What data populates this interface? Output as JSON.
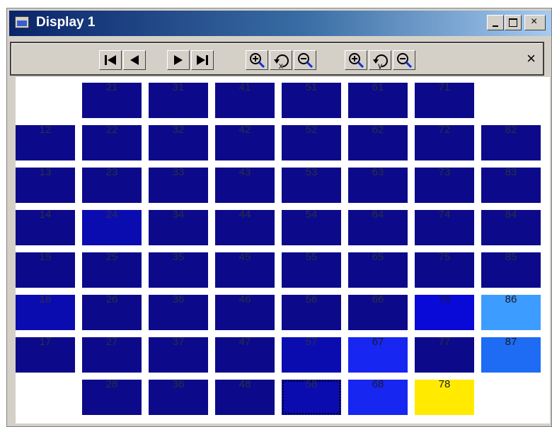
{
  "window": {
    "title": "Display 1",
    "buttons": {
      "minimize": "minimize",
      "maximize": "maximize",
      "close": "×"
    }
  },
  "toolbar": {
    "tools": [
      {
        "name": "first-frame-button",
        "icon": "skip-to-start-icon"
      },
      {
        "name": "previous-frame-button",
        "icon": "step-back-icon"
      },
      {
        "name": "next-frame-button",
        "icon": "step-forward-icon"
      },
      {
        "name": "last-frame-button",
        "icon": "skip-to-end-icon"
      },
      {
        "name": "zoom-in-x-button",
        "icon": "zoom-in-icon"
      },
      {
        "name": "reset-zoom-x-button",
        "icon": "reset-x-icon"
      },
      {
        "name": "zoom-out-x-button",
        "icon": "zoom-out-icon"
      },
      {
        "name": "zoom-in-y-button",
        "icon": "zoom-in-icon"
      },
      {
        "name": "reset-zoom-y-button",
        "icon": "reset-y-icon"
      },
      {
        "name": "zoom-out-y-button",
        "icon": "zoom-out-icon"
      }
    ],
    "close_label": "×"
  },
  "colors": {
    "dark": "#0c0a8a",
    "mid": "#0b0cb0",
    "bright": "#0a0ad8",
    "blue": "#1726f0",
    "sky": "#3d9cff",
    "azure": "#1e6cf4",
    "yellow": "#ffea00"
  },
  "cells": [
    {
      "label": "21",
      "col": 1,
      "row": 0,
      "color": "dark"
    },
    {
      "label": "31",
      "col": 2,
      "row": 0,
      "color": "dark"
    },
    {
      "label": "41",
      "col": 3,
      "row": 0,
      "color": "dark"
    },
    {
      "label": "51",
      "col": 4,
      "row": 0,
      "color": "dark"
    },
    {
      "label": "61",
      "col": 5,
      "row": 0,
      "color": "dark"
    },
    {
      "label": "71",
      "col": 6,
      "row": 0,
      "color": "dark"
    },
    {
      "label": "12",
      "col": 0,
      "row": 1,
      "color": "dark"
    },
    {
      "label": "22",
      "col": 1,
      "row": 1,
      "color": "dark"
    },
    {
      "label": "32",
      "col": 2,
      "row": 1,
      "color": "dark"
    },
    {
      "label": "42",
      "col": 3,
      "row": 1,
      "color": "dark"
    },
    {
      "label": "52",
      "col": 4,
      "row": 1,
      "color": "dark"
    },
    {
      "label": "62",
      "col": 5,
      "row": 1,
      "color": "dark"
    },
    {
      "label": "72",
      "col": 6,
      "row": 1,
      "color": "dark"
    },
    {
      "label": "82",
      "col": 7,
      "row": 1,
      "color": "dark"
    },
    {
      "label": "13",
      "col": 0,
      "row": 2,
      "color": "dark"
    },
    {
      "label": "23",
      "col": 1,
      "row": 2,
      "color": "dark"
    },
    {
      "label": "33",
      "col": 2,
      "row": 2,
      "color": "dark"
    },
    {
      "label": "43",
      "col": 3,
      "row": 2,
      "color": "dark"
    },
    {
      "label": "53",
      "col": 4,
      "row": 2,
      "color": "dark"
    },
    {
      "label": "63",
      "col": 5,
      "row": 2,
      "color": "dark"
    },
    {
      "label": "73",
      "col": 6,
      "row": 2,
      "color": "dark"
    },
    {
      "label": "83",
      "col": 7,
      "row": 2,
      "color": "dark"
    },
    {
      "label": "14",
      "col": 0,
      "row": 3,
      "color": "dark"
    },
    {
      "label": "24",
      "col": 1,
      "row": 3,
      "color": "mid"
    },
    {
      "label": "34",
      "col": 2,
      "row": 3,
      "color": "dark"
    },
    {
      "label": "44",
      "col": 3,
      "row": 3,
      "color": "dark"
    },
    {
      "label": "54",
      "col": 4,
      "row": 3,
      "color": "dark"
    },
    {
      "label": "64",
      "col": 5,
      "row": 3,
      "color": "dark"
    },
    {
      "label": "74",
      "col": 6,
      "row": 3,
      "color": "dark"
    },
    {
      "label": "84",
      "col": 7,
      "row": 3,
      "color": "dark"
    },
    {
      "label": "15",
      "col": 0,
      "row": 4,
      "color": "dark"
    },
    {
      "label": "25",
      "col": 1,
      "row": 4,
      "color": "dark"
    },
    {
      "label": "35",
      "col": 2,
      "row": 4,
      "color": "dark"
    },
    {
      "label": "45",
      "col": 3,
      "row": 4,
      "color": "dark"
    },
    {
      "label": "55",
      "col": 4,
      "row": 4,
      "color": "dark"
    },
    {
      "label": "65",
      "col": 5,
      "row": 4,
      "color": "dark"
    },
    {
      "label": "75",
      "col": 6,
      "row": 4,
      "color": "dark"
    },
    {
      "label": "85",
      "col": 7,
      "row": 4,
      "color": "dark"
    },
    {
      "label": "16",
      "col": 0,
      "row": 5,
      "color": "mid"
    },
    {
      "label": "26",
      "col": 1,
      "row": 5,
      "color": "dark"
    },
    {
      "label": "36",
      "col": 2,
      "row": 5,
      "color": "dark"
    },
    {
      "label": "46",
      "col": 3,
      "row": 5,
      "color": "dark"
    },
    {
      "label": "56",
      "col": 4,
      "row": 5,
      "color": "dark"
    },
    {
      "label": "66",
      "col": 5,
      "row": 5,
      "color": "dark"
    },
    {
      "label": "76",
      "col": 6,
      "row": 5,
      "color": "bright"
    },
    {
      "label": "86",
      "col": 7,
      "row": 5,
      "color": "sky"
    },
    {
      "label": "17",
      "col": 0,
      "row": 6,
      "color": "dark"
    },
    {
      "label": "27",
      "col": 1,
      "row": 6,
      "color": "dark"
    },
    {
      "label": "37",
      "col": 2,
      "row": 6,
      "color": "dark"
    },
    {
      "label": "47",
      "col": 3,
      "row": 6,
      "color": "dark"
    },
    {
      "label": "57",
      "col": 4,
      "row": 6,
      "color": "mid"
    },
    {
      "label": "67",
      "col": 5,
      "row": 6,
      "color": "blue"
    },
    {
      "label": "77",
      "col": 6,
      "row": 6,
      "color": "dark"
    },
    {
      "label": "87",
      "col": 7,
      "row": 6,
      "color": "azure"
    },
    {
      "label": "28",
      "col": 1,
      "row": 7,
      "color": "dark"
    },
    {
      "label": "38",
      "col": 2,
      "row": 7,
      "color": "dark"
    },
    {
      "label": "48",
      "col": 3,
      "row": 7,
      "color": "dark"
    },
    {
      "label": "58",
      "col": 4,
      "row": 7,
      "color": "mid",
      "selected": true
    },
    {
      "label": "68",
      "col": 5,
      "row": 7,
      "color": "blue"
    },
    {
      "label": "78",
      "col": 6,
      "row": 7,
      "color": "yellow"
    }
  ]
}
